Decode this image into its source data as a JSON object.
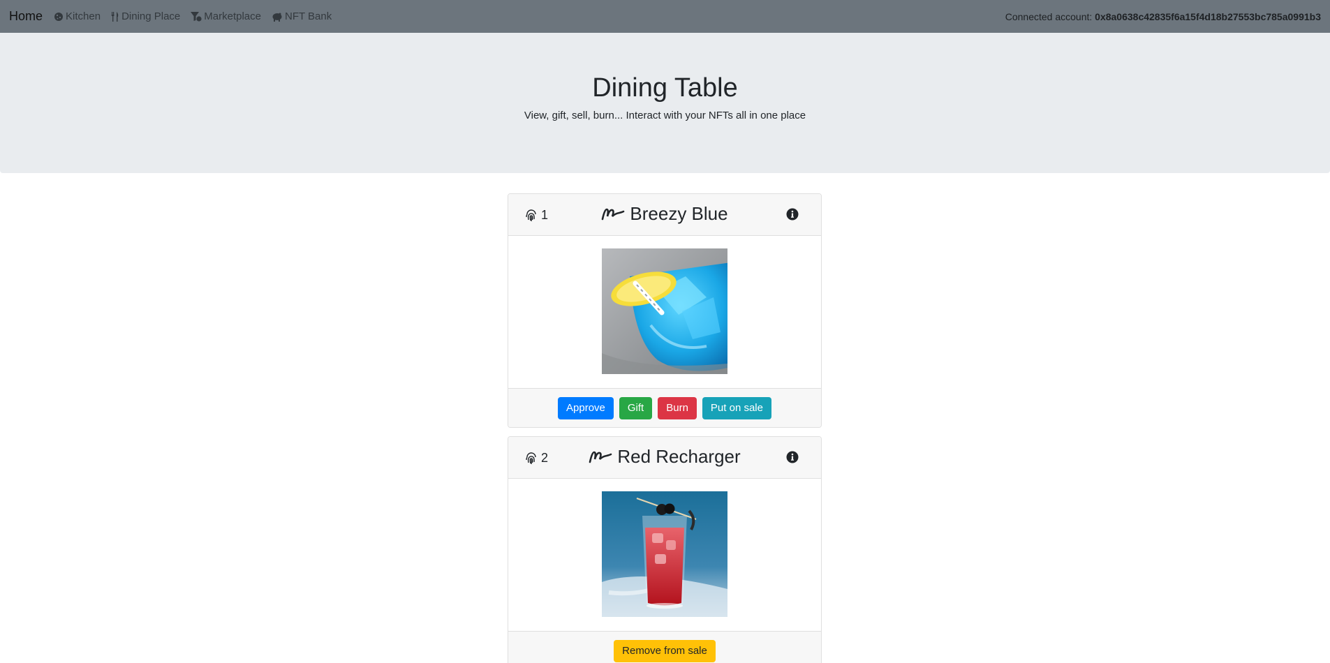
{
  "navbar": {
    "brand": "Home",
    "links": [
      {
        "label": "Kitchen",
        "icon": "cookie-icon"
      },
      {
        "label": "Dining Place",
        "icon": "utensils-icon"
      },
      {
        "label": "Marketplace",
        "icon": "funnel-dollar-icon"
      },
      {
        "label": "NFT Bank",
        "icon": "piggy-bank-icon"
      }
    ],
    "account_label": "Connected account:",
    "account_address": "0x8a0638c42835f6a15f4d18b27553bc785a0991b3"
  },
  "jumbotron": {
    "title": "Dining Table",
    "subtitle": "View, gift, sell, burn... Interact with your NFTs all in one place"
  },
  "cards": [
    {
      "token_id": "1",
      "name": "Breezy Blue",
      "image": "blue-cocktail",
      "buttons": [
        "Approve",
        "Gift",
        "Burn",
        "Put on sale"
      ]
    },
    {
      "token_id": "2",
      "name": "Red Recharger",
      "image": "red-cocktail",
      "buttons": [
        "Remove from sale"
      ]
    }
  ],
  "colors": {
    "navbar": "#6c757d",
    "jumbotron": "#e9ecef",
    "primary": "#007bff",
    "success": "#28a745",
    "danger": "#dc3545",
    "info": "#17a2b8",
    "warning": "#ffc107"
  }
}
